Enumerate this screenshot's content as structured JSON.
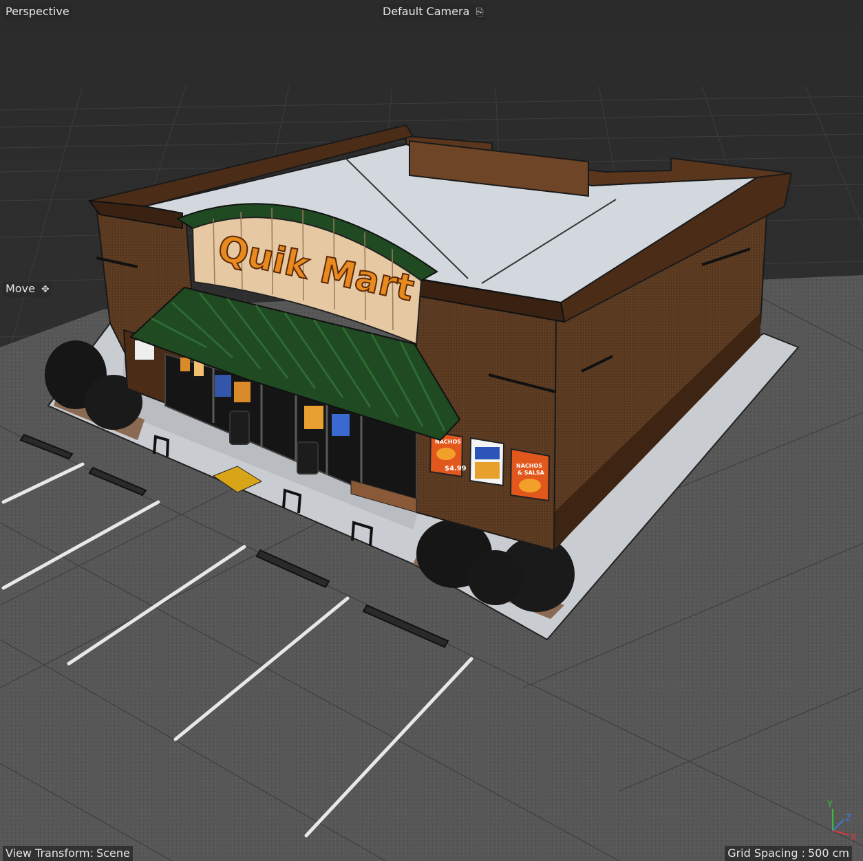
{
  "viewport": {
    "view_label": "Perspective",
    "camera_label": "Default Camera",
    "camera_icon": "camera-link-icon",
    "tool_label": "Move",
    "tool_icon": "move-arrows-icon",
    "view_transform_prefix": "View Transform:",
    "view_transform_value": "Scene",
    "grid_spacing_prefix": "Grid Spacing :",
    "grid_spacing_value": "500 cm"
  },
  "scene": {
    "store_sign": "Quik Mart",
    "poster_1_top": "NACHOS",
    "poster_1_price": "$4.99",
    "poster_3_line1": "NACHOS",
    "poster_3_line2": "& SALSA"
  },
  "axis_gizmo": {
    "y_label": "Y",
    "z_label": "Z",
    "x_label": "X"
  },
  "colors": {
    "background": "#2a2a2a",
    "grid_line": "#3a3a3a",
    "ground": "#545454",
    "sidewalk": "#c9ccd0",
    "roof": "#cfd5da",
    "brick": "#5b3b22",
    "trim": "#3a2212",
    "awning": "#1f4a22",
    "sign_text": "#e88a1e",
    "axis_x": "#d23b3b",
    "axis_y": "#3bbf3b",
    "axis_z": "#3b7bd2"
  }
}
